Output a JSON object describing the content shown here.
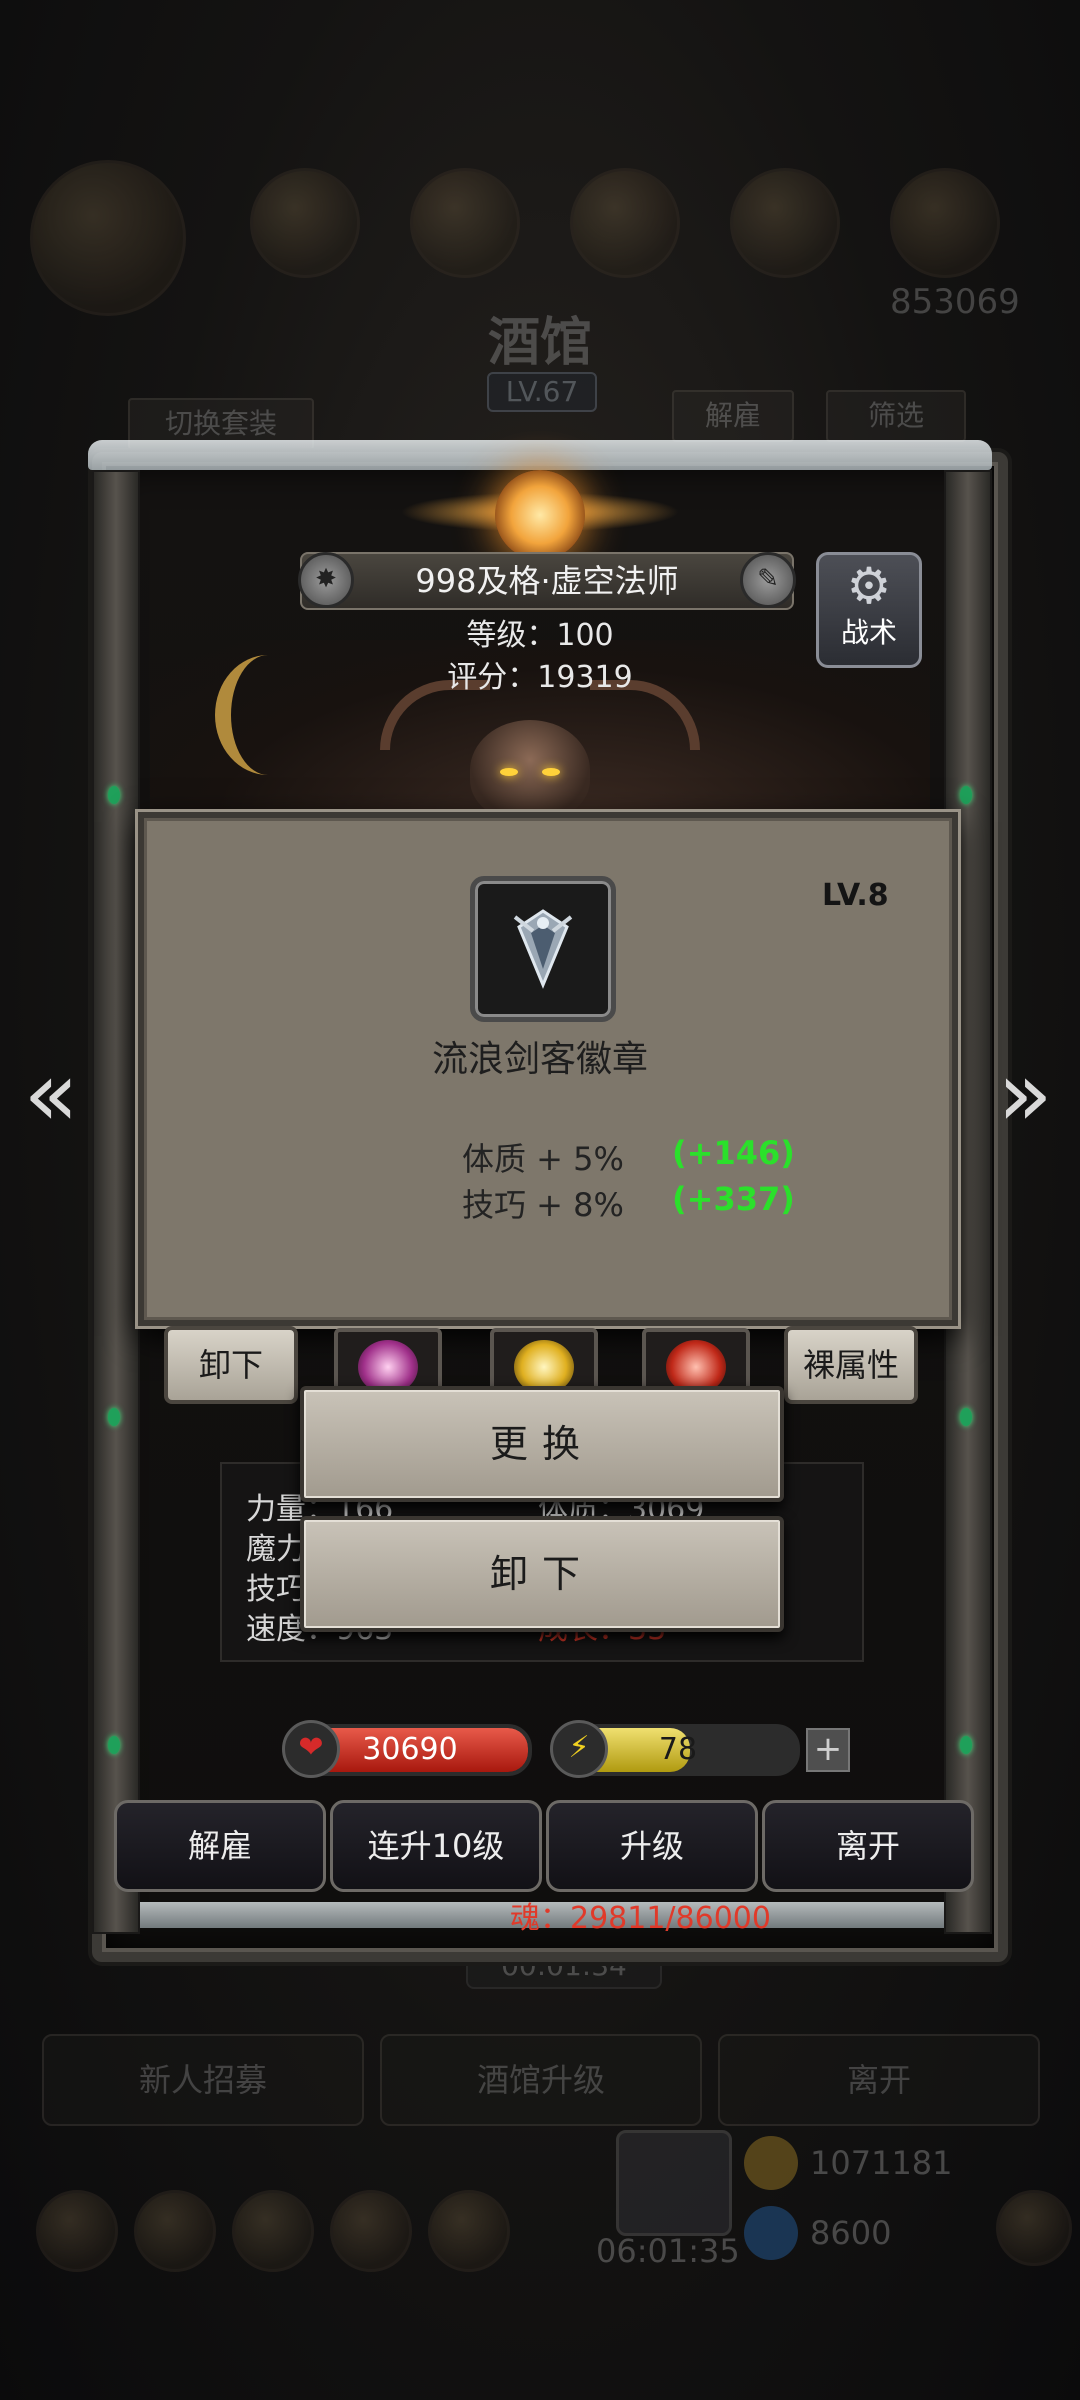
{
  "background": {
    "title": "酒馆",
    "level": "LV.67",
    "switch_set_label": "切换套装",
    "dismiss_label": "解雇",
    "filter_label": "筛选",
    "top_right_number": "853069",
    "timer": "00:01:34",
    "recruit_label": "新人招募",
    "tavern_upgrade_label": "酒馆升级",
    "leave_label": "离开",
    "gold": "1071181",
    "gems": "8600",
    "gift_timer": "06:01:35"
  },
  "hero": {
    "name": "998及格·虚空法师",
    "level_text": "等级：100",
    "score_text": "评分：19319",
    "tactics_label": "战术"
  },
  "item": {
    "level": "LV.8",
    "name": "流浪剑客徽章",
    "stats": [
      {
        "text": "体质 + 5%",
        "bonus": "(+146)"
      },
      {
        "text": "技巧 + 8%",
        "bonus": "(+337)"
      }
    ]
  },
  "equip_row": {
    "unequip_label": "卸下",
    "bare_attr_label": "裸属性"
  },
  "hero_stats": {
    "line1_left": "力量：166",
    "line1_right": "体质：3069",
    "line2_left": "魔力：",
    "line3_left": "技巧：",
    "line4_left": "速度：963",
    "line4_right": "成长：33"
  },
  "context_menu": {
    "replace_label": "更换",
    "unequip_label": "卸下"
  },
  "resources": {
    "hp": "30690",
    "energy": "78",
    "energy_fraction": 0.55,
    "plus": "+"
  },
  "actions": {
    "dismiss": "解雇",
    "level_up_10": "连升10级",
    "level_up": "升级",
    "leave": "离开"
  },
  "soul": "魂：29811/86000",
  "nav": {
    "prev": "«",
    "next": "»"
  },
  "icons": {
    "gear": "⚙",
    "edit": "✎",
    "badge": "✸",
    "heart": "❤",
    "lightning": "⚡"
  }
}
